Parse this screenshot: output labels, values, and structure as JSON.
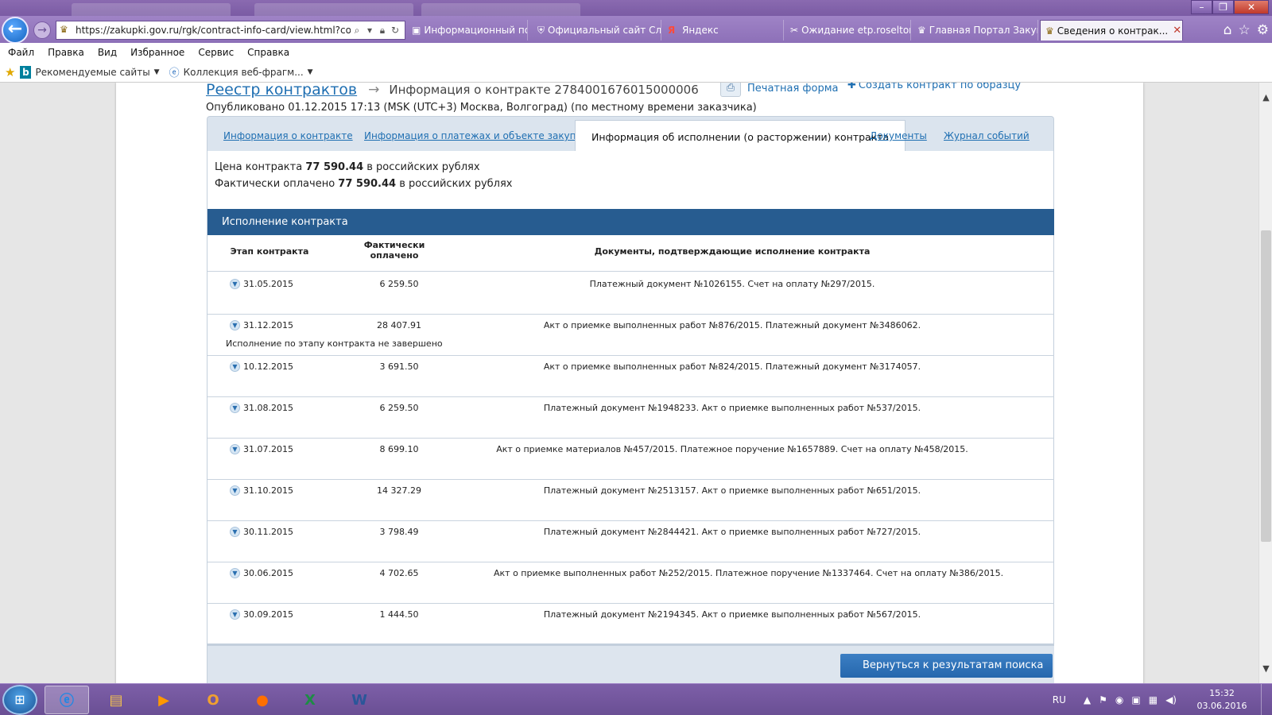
{
  "browser": {
    "address_url": "https://zakupki.gov.ru/rgk/contract-info-card/view.html?contrac",
    "tabs": [
      {
        "label": "Информационный по..."
      },
      {
        "label": "Официальный сайт Сл..."
      },
      {
        "label": "Яндекс"
      },
      {
        "label": "Ожидание etp.roseltor..."
      },
      {
        "label": "Главная Портал Закуп..."
      },
      {
        "label": "Сведения о контрак..."
      }
    ],
    "menu": [
      "Файл",
      "Правка",
      "Вид",
      "Избранное",
      "Сервис",
      "Справка"
    ],
    "favorites": [
      {
        "label": "Рекомендуемые сайты",
        "icon": "bing-icon"
      },
      {
        "label": "Коллекция веб-фрагм...",
        "icon": "ie-icon"
      }
    ]
  },
  "page": {
    "breadcrumb_registry": "Реестр контрактов",
    "breadcrumb_current": "Информация о контракте 2784001676015000006",
    "print_label": "Печатная форма",
    "template_label": "Создать контракт по образцу",
    "published": "Опубликовано 01.12.2015 17:13 (MSK (UTC+3) Москва, Волгоград) (по местному времени заказчика)",
    "tabs": [
      {
        "label": "Информация о контракте"
      },
      {
        "label": "Информация о платежах и объекте закупки"
      },
      {
        "label": "Информация об исполнении (о расторжении) контракта"
      },
      {
        "label": "Документы"
      },
      {
        "label": "Журнал событий"
      }
    ],
    "price_prefix": "Цена контракта",
    "price_value": "77 590.44",
    "price_suffix": "в российских рублях",
    "paid_prefix": "Фактически оплачено",
    "paid_value": "77 590.44",
    "paid_suffix": "в российских рублях",
    "section_title": "Исполнение контракта",
    "col_stage": "Этап контракта",
    "col_paid": "Фактически оплачено",
    "col_docs": "Документы, подтверждающие исполнение контракта",
    "rows": [
      {
        "date": "31.05.2015",
        "amount": "6 259.50",
        "docs": "Платежный документ №1026155. Счет на оплату №297/2015.",
        "note": ""
      },
      {
        "date": "31.12.2015",
        "amount": "28 407.91",
        "docs": "Акт о приемке выполненных работ №876/2015. Платежный документ №3486062.",
        "note": "Исполнение по этапу контракта не завершено"
      },
      {
        "date": "10.12.2015",
        "amount": "3 691.50",
        "docs": "Акт о приемке выполненных работ №824/2015. Платежный документ №3174057.",
        "note": ""
      },
      {
        "date": "31.08.2015",
        "amount": "6 259.50",
        "docs": "Платежный документ №1948233. Акт о приемке выполненных работ №537/2015.",
        "note": ""
      },
      {
        "date": "31.07.2015",
        "amount": "8 699.10",
        "docs": "Акт о приемке материалов №457/2015. Платежное поручение №1657889. Счет на оплату №458/2015.",
        "note": ""
      },
      {
        "date": "31.10.2015",
        "amount": "14 327.29",
        "docs": "Платежный документ №2513157. Акт о приемке выполненных работ №651/2015.",
        "note": ""
      },
      {
        "date": "30.11.2015",
        "amount": "3 798.49",
        "docs": "Платежный документ №2844421. Акт о приемке выполненных работ №727/2015.",
        "note": ""
      },
      {
        "date": "30.06.2015",
        "amount": "4 702.65",
        "docs": "Акт о приемке выполненных работ №252/2015. Платежное поручение №1337464. Счет на оплату №386/2015.",
        "note": ""
      },
      {
        "date": "30.09.2015",
        "amount": "1 444.50",
        "docs": "Платежный документ №2194345. Акт о приемке выполненных работ №567/2015.",
        "note": ""
      }
    ],
    "back_button": "Вернуться к результатам поиска"
  },
  "taskbar": {
    "apps": [
      "internet-explorer-icon",
      "file-explorer-icon",
      "media-player-icon",
      "outlook-icon",
      "firefox-icon",
      "excel-icon",
      "word-icon"
    ],
    "lang": "RU",
    "time": "15:32",
    "date": "03.06.2016"
  },
  "colors": {
    "accent": "#275c90",
    "link": "#1f6fb2",
    "chrome": "#8d70b8"
  }
}
